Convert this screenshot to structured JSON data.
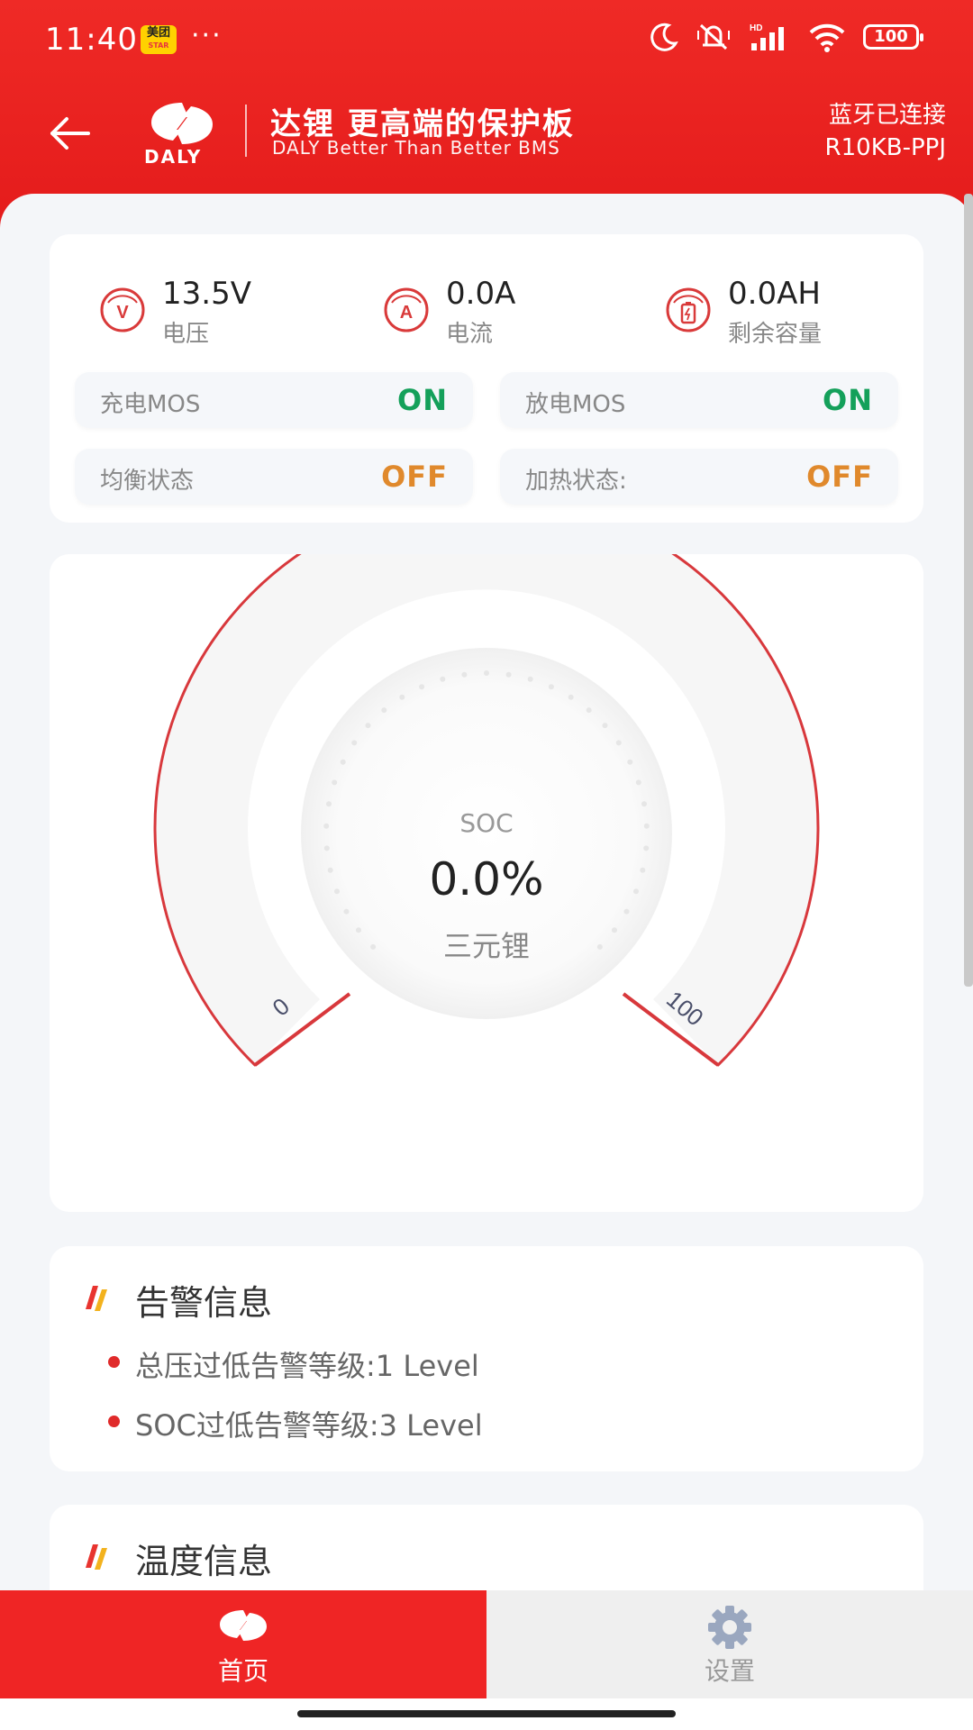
{
  "status_bar": {
    "time": "11:40",
    "app_badge": "美团",
    "app_badge_sub": "STAR",
    "more": "···",
    "network": "HD",
    "battery": "100"
  },
  "header": {
    "logo_text": "DALY",
    "title": "达锂 更高端的保护板",
    "subtitle": "DALY Better Than Better BMS",
    "bluetooth_status": "蓝牙已连接",
    "device_name": "R10KB-PPJ"
  },
  "metrics": [
    {
      "value": "13.5V",
      "label": "电压",
      "icon": "voltage-icon"
    },
    {
      "value": "0.0A",
      "label": "电流",
      "icon": "current-icon"
    },
    {
      "value": "0.0AH",
      "label": "剩余容量",
      "icon": "capacity-icon"
    }
  ],
  "states": {
    "charge_mos": {
      "label": "充电MOS",
      "value": "ON"
    },
    "discharge_mos": {
      "label": "放电MOS",
      "value": "ON"
    },
    "balance": {
      "label": "均衡状态",
      "value": "OFF"
    },
    "heating": {
      "label": "加热状态:",
      "value": "OFF"
    }
  },
  "gauge": {
    "label": "SOC",
    "value": "0.0%",
    "soc_percent": 0,
    "battery_type": "三元锂",
    "min_label": "0",
    "max_label": "100"
  },
  "alarms": {
    "title": "告警信息",
    "items": [
      "总压过低告警等级:1 Level",
      "SOC过低告警等级:3 Level"
    ]
  },
  "temperature": {
    "title": "温度信息"
  },
  "tabs": {
    "home": "首页",
    "settings": "设置"
  },
  "colors": {
    "brand_red": "#ef2525",
    "on_green": "#14a05a",
    "off_orange": "#e0892c"
  }
}
